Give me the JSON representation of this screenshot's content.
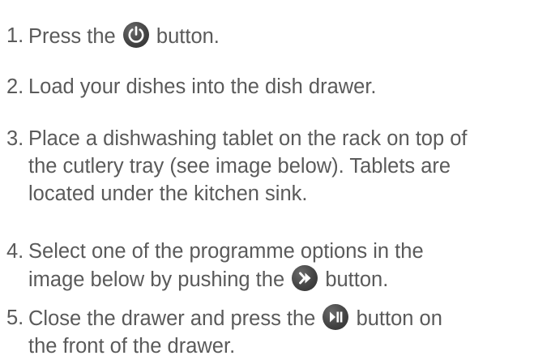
{
  "steps": [
    {
      "number": "1.",
      "before": "Press the",
      "icon": "power-icon",
      "after": "button."
    },
    {
      "number": "2.",
      "text": "Load your dishes into the dish drawer."
    },
    {
      "number": "3.",
      "line1": "Place a dishwashing tablet on the rack on top of",
      "line2": "the cutlery tray (see image below). Tablets are",
      "line3": "located under the kitchen sink."
    },
    {
      "number": "4.",
      "line1": "Select one of the programme options in the",
      "before": "image below by pushing the",
      "icon": "fast-forward-icon",
      "after": "button."
    },
    {
      "number": "5.",
      "before": "Close the drawer and press the",
      "icon": "play-pause-icon",
      "after": "button on",
      "line2": "the front of the drawer."
    }
  ],
  "colors": {
    "text": "#5a5a5a",
    "button": "#444444",
    "icon_glyph": "#ffffff"
  }
}
